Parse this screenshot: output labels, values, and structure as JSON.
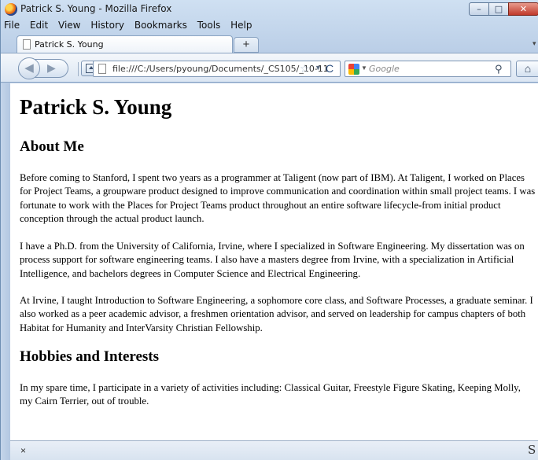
{
  "window": {
    "title": "Patrick S. Young - Mozilla Firefox",
    "controls": {
      "minimize": "–",
      "maximize": "□",
      "close": "✕"
    }
  },
  "menu": [
    "File",
    "Edit",
    "View",
    "History",
    "Bookmarks",
    "Tools",
    "Help"
  ],
  "tab": {
    "label": "Patrick S. Young",
    "new_tab": "+"
  },
  "nav": {
    "url": "file:///C:/Users/pyoung/Documents/_CS105/_10-11",
    "search_placeholder": "Google",
    "icons": {
      "back": "back-arrow-icon",
      "forward": "forward-arrow-icon",
      "star": "bookmark-star-icon",
      "reload": "reload-icon",
      "search": "magnifier-icon",
      "home": "home-icon"
    }
  },
  "page": {
    "title": "Patrick S. Young",
    "about_heading": "About Me",
    "about_p1": "Before coming to Stanford, I spent two years as a programmer at Taligent (now part of IBM). At Taligent, I worked on Places for Project Teams, a groupware product designed to improve communication and coordination within small project teams. I was fortunate to work with the Places for Project Teams product throughout an entire software lifecycle-from initial product conception through the actual product launch.",
    "about_p2": "I have a Ph.D. from the University of California, Irvine, where I specialized in Software Engineering. My dissertation was on process support for software engineering teams. I also have a masters degree from Irvine, with a specialization in Artificial Intelligence, and bachelors degrees in Computer Science and Electrical Engineering.",
    "about_p3": "At Irvine, I taught Introduction to Software Engineering, a sophomore core class, and Software Processes, a graduate seminar. I also worked as a peer academic advisor, a freshmen orientation advisor, and served on leadership for campus chapters of both Habitat for Humanity and InterVarsity Christian Fellowship.",
    "hobbies_heading": "Hobbies and Interests",
    "hobbies_p1": "In my spare time, I participate in a variety of activities including: Classical Guitar, Freestyle Figure Skating, Keeping Molly, my Cairn Terrier, out of trouble."
  },
  "status": {
    "close": "×",
    "addon": "S"
  }
}
